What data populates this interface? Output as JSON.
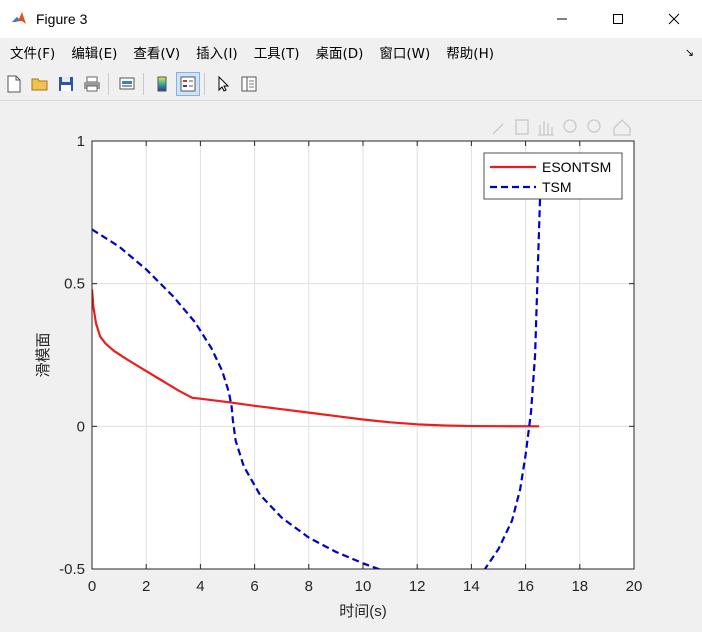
{
  "window": {
    "title": "Figure 3"
  },
  "menu": {
    "items": [
      "文件(F)",
      "编辑(E)",
      "查看(V)",
      "插入(I)",
      "工具(T)",
      "桌面(D)",
      "窗口(W)",
      "帮助(H)"
    ]
  },
  "chart_data": {
    "type": "line",
    "xlabel": "时间(s)",
    "ylabel": "滑模面",
    "xlim": [
      0,
      20
    ],
    "ylim": [
      -0.5,
      1
    ],
    "xticks": [
      0,
      2,
      4,
      6,
      8,
      10,
      12,
      14,
      16,
      18,
      20
    ],
    "yticks": [
      -0.5,
      0,
      0.5,
      1
    ],
    "xtick_labels": [
      "0",
      "2",
      "4",
      "6",
      "8",
      "10",
      "12",
      "14",
      "16",
      "18",
      "20"
    ],
    "ytick_labels": [
      "-0.5",
      "0",
      "0.5",
      "1"
    ],
    "grid": true,
    "legend": "top-right",
    "series": [
      {
        "name": "ESONTSM",
        "color": "#ee1c1c",
        "style": "solid",
        "x": [
          0,
          0.05,
          0.15,
          0.3,
          0.5,
          0.8,
          1.2,
          1.8,
          2.5,
          3.2,
          3.7,
          4.0,
          5.0,
          6.0,
          7.0,
          8.0,
          9.0,
          10.0,
          11.0,
          12.0,
          13.0,
          14.0,
          15.0,
          16.0,
          16.5
        ],
        "y": [
          0.48,
          0.42,
          0.36,
          0.315,
          0.29,
          0.265,
          0.24,
          0.205,
          0.165,
          0.125,
          0.1,
          0.097,
          0.085,
          0.072,
          0.06,
          0.048,
          0.036,
          0.024,
          0.014,
          0.007,
          0.003,
          0.001,
          0.0005,
          0.0002,
          0.0
        ]
      },
      {
        "name": "TSM",
        "color": "#0000cc",
        "style": "dashed",
        "x": [
          0,
          1,
          2,
          3,
          3.8,
          4.4,
          4.8,
          5.05,
          5.15,
          5.2,
          5.3,
          5.6,
          6.2,
          7.0,
          8.0,
          9.0,
          10.0,
          11.0,
          12.0,
          13.0,
          14.0,
          14.5,
          15.0,
          15.5,
          15.8,
          16.0,
          16.2,
          16.35,
          16.45,
          16.55
        ],
        "y": [
          0.69,
          0.63,
          0.55,
          0.455,
          0.365,
          0.275,
          0.195,
          0.12,
          0.07,
          0.02,
          -0.05,
          -0.14,
          -0.24,
          -0.32,
          -0.39,
          -0.44,
          -0.48,
          -0.515,
          -0.55,
          -0.575,
          -0.55,
          -0.5,
          -0.43,
          -0.33,
          -0.22,
          -0.1,
          0.05,
          0.25,
          0.55,
          0.85
        ]
      }
    ]
  }
}
